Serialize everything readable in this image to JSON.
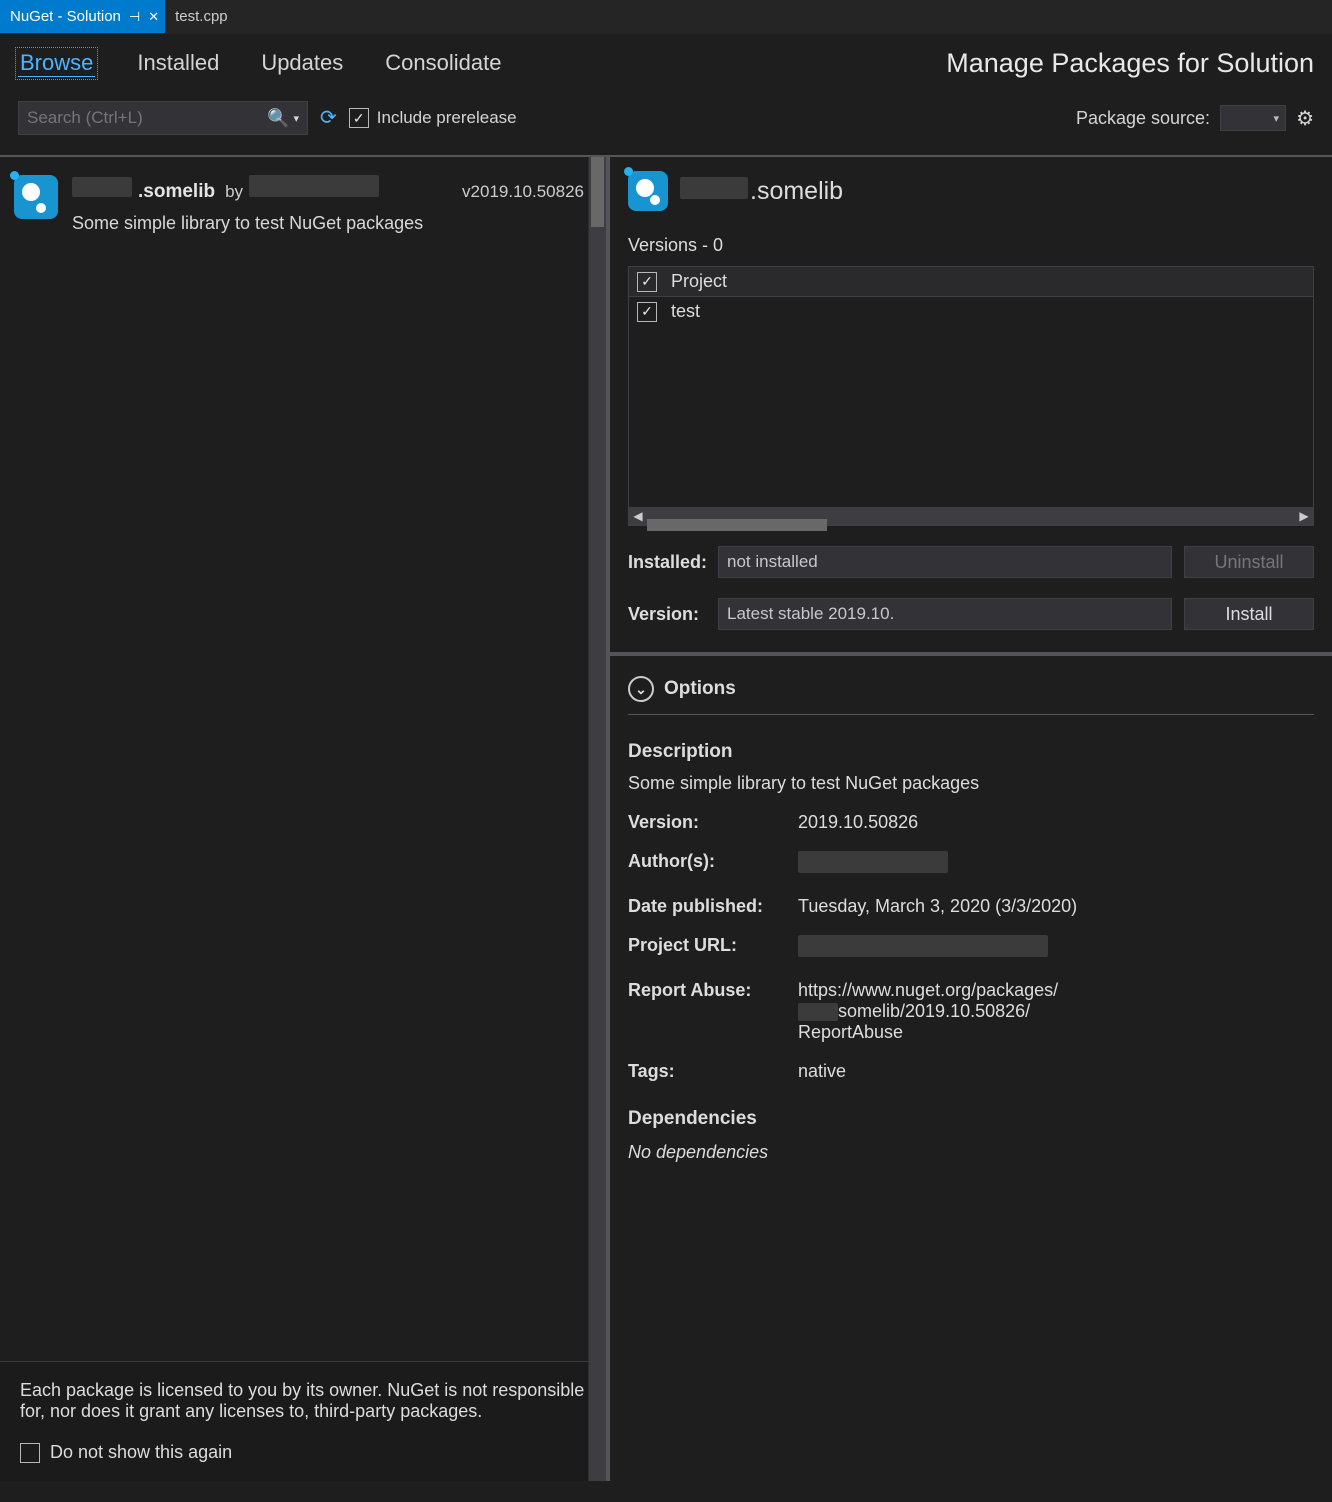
{
  "tabs": [
    {
      "label": "NuGet - Solution",
      "active": true
    },
    {
      "label": "test.cpp",
      "active": false
    }
  ],
  "nav": {
    "browse": "Browse",
    "installed": "Installed",
    "updates": "Updates",
    "consolidate": "Consolidate"
  },
  "heading": "Manage Packages for Solution",
  "search": {
    "placeholder": "Search (Ctrl+L)"
  },
  "prerelease_label": "Include prerelease",
  "pkgsource_label": "Package source:",
  "package": {
    "suffix": ".somelib",
    "by": "by",
    "version": "v2019.10.50826",
    "desc": "Some simple library to test NuGet packages"
  },
  "license": {
    "line": "Each package is licensed to you by its owner. NuGet is not responsible for, nor does it grant any licenses to, third-party packages.",
    "checkbox": "Do not show this again"
  },
  "right": {
    "title_suffix": ".somelib",
    "versions_label": "Versions - 0",
    "project_header": "Project",
    "project_row": "test",
    "installed_label": "Installed:",
    "installed_value": "not installed",
    "uninstall": "Uninstall",
    "version_label": "Version:",
    "version_value": "Latest stable 2019.10.",
    "install": "Install",
    "options": "Options",
    "description_title": "Description",
    "description_text": "Some simple library to test NuGet packages",
    "meta": {
      "version_k": "Version:",
      "version_v": "2019.10.50826",
      "authors_k": "Author(s):",
      "date_k": "Date published:",
      "date_v": "Tuesday, March 3, 2020 (3/3/2020)",
      "projecturl_k": "Project URL:",
      "abuse_k": "Report Abuse:",
      "abuse_line1": "https://www.nuget.org/packages/",
      "abuse_line2": "somelib/2019.10.50826/",
      "abuse_line3": "ReportAbuse",
      "tags_k": "Tags:",
      "tags_v": "native",
      "dep_title": "Dependencies",
      "dep_none": "No dependencies"
    }
  }
}
